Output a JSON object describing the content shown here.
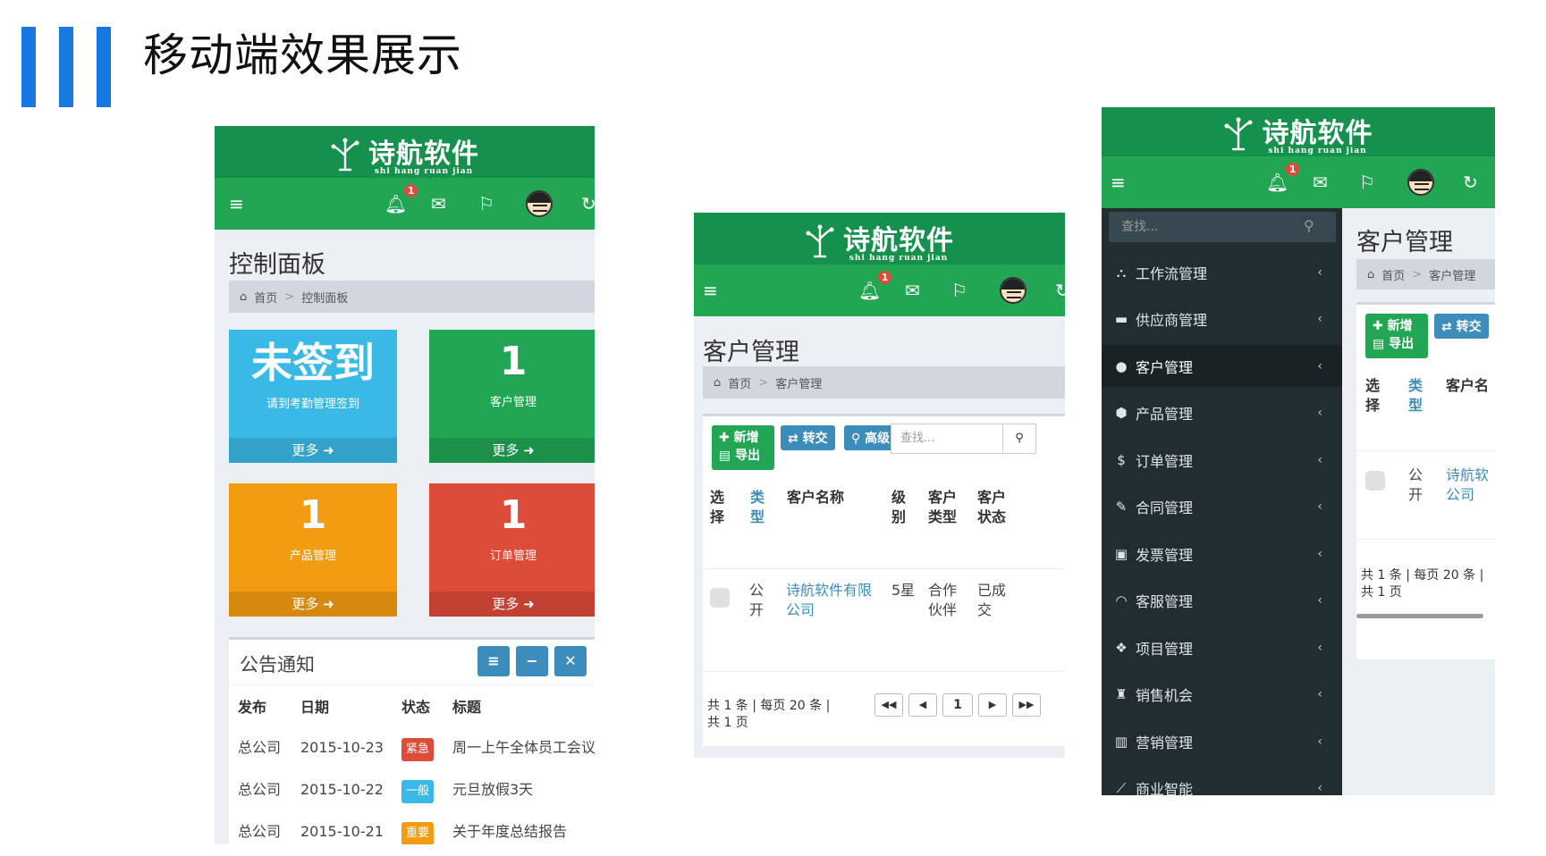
{
  "slide": {
    "title": "移动端效果展示"
  },
  "brand": {
    "logo": "诗航软件",
    "logo_sub": "shi hang ruan jian"
  },
  "nav": {
    "bell_badge": "1"
  },
  "dashboard": {
    "title": "控制面板",
    "breadcrumb": {
      "home": "首页",
      "current": "控制面板"
    },
    "tiles": [
      {
        "big": "未签到",
        "sub": "请到考勤管理签到",
        "more": "更多",
        "color": "#39b9e6"
      },
      {
        "big": "1",
        "sub": "客户管理",
        "more": "更多",
        "color": "#22a654"
      },
      {
        "big": "1",
        "sub": "产品管理",
        "more": "更多",
        "color": "#f39c12"
      },
      {
        "big": "1",
        "sub": "订单管理",
        "more": "更多",
        "color": "#dd4b39"
      }
    ],
    "notice": {
      "title": "公告通知",
      "headers": [
        "发布",
        "日期",
        "状态",
        "标题"
      ],
      "rows": [
        {
          "pub": "总公司",
          "date": "2015-10-23",
          "status": "紧急",
          "status_color": "#dd4b39",
          "title": "周一上午全体员工会议"
        },
        {
          "pub": "总公司",
          "date": "2015-10-22",
          "status": "一般",
          "status_color": "#39b9e6",
          "title": "元旦放假3天"
        },
        {
          "pub": "总公司",
          "date": "2015-10-21",
          "status": "重要",
          "status_color": "#f39c12",
          "title": "关于年度总结报告"
        }
      ]
    }
  },
  "customer": {
    "title": "客户管理",
    "breadcrumb": {
      "home": "首页",
      "current": "客户管理"
    },
    "buttons": {
      "add": "新增",
      "export": "导出",
      "transfer": "转交",
      "advanced": "高级"
    },
    "search_placeholder": "查找...",
    "headers": {
      "select": "选择",
      "type": "类型",
      "name": "客户名称",
      "level": "级别",
      "ctype": "客户类型",
      "cstatus": "客户状态"
    },
    "row": {
      "type": "公开",
      "name": "诗航软件有限公司",
      "level": "5星",
      "ctype": "合作伙伴",
      "cstatus": "已成交"
    },
    "pagination": {
      "line1": "共 1 条 | 每页 20 条 |",
      "line2": "共 1 页",
      "page": "1"
    }
  },
  "sidebar": {
    "search_placeholder": "查找...",
    "items": [
      {
        "icon": "sitemap-icon",
        "glyph": "⛬",
        "label": "工作流管理"
      },
      {
        "icon": "truck-icon",
        "glyph": "▬",
        "label": "供应商管理"
      },
      {
        "icon": "user-icon",
        "glyph": "●",
        "label": "客户管理"
      },
      {
        "icon": "cube-icon",
        "glyph": "⬢",
        "label": "产品管理"
      },
      {
        "icon": "dollar-icon",
        "glyph": "$",
        "label": "订单管理"
      },
      {
        "icon": "pencil-icon",
        "glyph": "✎",
        "label": "合同管理"
      },
      {
        "icon": "invoice-icon",
        "glyph": "▣",
        "label": "发票管理"
      },
      {
        "icon": "headset-icon",
        "glyph": "◠",
        "label": "客服管理"
      },
      {
        "icon": "cubes-icon",
        "glyph": "❖",
        "label": "项目管理"
      },
      {
        "icon": "binoculars-icon",
        "glyph": "♜",
        "label": "销售机会"
      },
      {
        "icon": "bar-chart-icon",
        "glyph": "▥",
        "label": "营销管理"
      },
      {
        "icon": "line-chart-icon",
        "glyph": "⟋",
        "label": "商业智能"
      }
    ],
    "active_index": 2
  },
  "customer3": {
    "title": "客户管理",
    "breadcrumb": {
      "home": "首页",
      "current": "客户管理"
    },
    "headers": {
      "select": "选择",
      "type": "类型",
      "name": "客户名"
    },
    "row": {
      "type": "公开",
      "name": "诗航软公司"
    },
    "pagination": {
      "line1": "共 1 条 | 每页 20 条 |",
      "line2": "共 1 页"
    }
  }
}
